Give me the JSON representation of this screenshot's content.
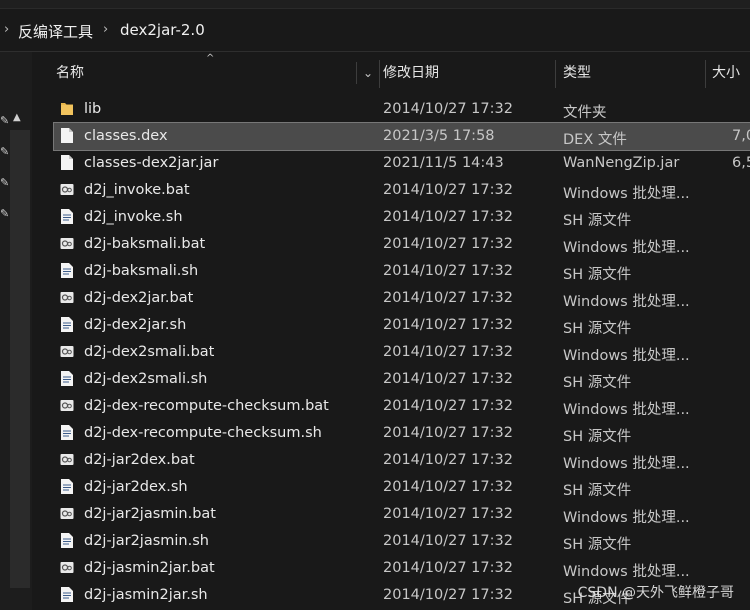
{
  "breadcrumb": {
    "items": [
      "反编译工具",
      "dex2jar-2.0"
    ]
  },
  "columns": {
    "name": "名称",
    "date": "修改日期",
    "type": "类型",
    "size": "大小"
  },
  "files": [
    {
      "name": "lib",
      "date": "2014/10/27 17:32",
      "type": "文件夹",
      "size": "",
      "icon": "folder-icon"
    },
    {
      "name": "classes.dex",
      "date": "2021/3/5 17:58",
      "type": "DEX 文件",
      "size": "7,0",
      "icon": "file-icon",
      "selected": true
    },
    {
      "name": "classes-dex2jar.jar",
      "date": "2021/11/5 14:43",
      "type": "WanNengZip.jar",
      "size": "6,5",
      "icon": "file-icon"
    },
    {
      "name": "d2j_invoke.bat",
      "date": "2014/10/27 17:32",
      "type": "Windows 批处理...",
      "size": "",
      "icon": "batch-file-icon"
    },
    {
      "name": "d2j_invoke.sh",
      "date": "2014/10/27 17:32",
      "type": "SH 源文件",
      "size": "",
      "icon": "script-file-icon"
    },
    {
      "name": "d2j-baksmali.bat",
      "date": "2014/10/27 17:32",
      "type": "Windows 批处理...",
      "size": "",
      "icon": "batch-file-icon"
    },
    {
      "name": "d2j-baksmali.sh",
      "date": "2014/10/27 17:32",
      "type": "SH 源文件",
      "size": "",
      "icon": "script-file-icon"
    },
    {
      "name": "d2j-dex2jar.bat",
      "date": "2014/10/27 17:32",
      "type": "Windows 批处理...",
      "size": "",
      "icon": "batch-file-icon"
    },
    {
      "name": "d2j-dex2jar.sh",
      "date": "2014/10/27 17:32",
      "type": "SH 源文件",
      "size": "",
      "icon": "script-file-icon"
    },
    {
      "name": "d2j-dex2smali.bat",
      "date": "2014/10/27 17:32",
      "type": "Windows 批处理...",
      "size": "",
      "icon": "batch-file-icon"
    },
    {
      "name": "d2j-dex2smali.sh",
      "date": "2014/10/27 17:32",
      "type": "SH 源文件",
      "size": "",
      "icon": "script-file-icon"
    },
    {
      "name": "d2j-dex-recompute-checksum.bat",
      "date": "2014/10/27 17:32",
      "type": "Windows 批处理...",
      "size": "",
      "icon": "batch-file-icon"
    },
    {
      "name": "d2j-dex-recompute-checksum.sh",
      "date": "2014/10/27 17:32",
      "type": "SH 源文件",
      "size": "",
      "icon": "script-file-icon"
    },
    {
      "name": "d2j-jar2dex.bat",
      "date": "2014/10/27 17:32",
      "type": "Windows 批处理...",
      "size": "",
      "icon": "batch-file-icon"
    },
    {
      "name": "d2j-jar2dex.sh",
      "date": "2014/10/27 17:32",
      "type": "SH 源文件",
      "size": "",
      "icon": "script-file-icon"
    },
    {
      "name": "d2j-jar2jasmin.bat",
      "date": "2014/10/27 17:32",
      "type": "Windows 批处理...",
      "size": "",
      "icon": "batch-file-icon"
    },
    {
      "name": "d2j-jar2jasmin.sh",
      "date": "2014/10/27 17:32",
      "type": "SH 源文件",
      "size": "",
      "icon": "script-file-icon"
    },
    {
      "name": "d2j-jasmin2jar.bat",
      "date": "2014/10/27 17:32",
      "type": "Windows 批处理...",
      "size": "",
      "icon": "batch-file-icon"
    },
    {
      "name": "d2j-jasmin2jar.sh",
      "date": "2014/10/27 17:32",
      "type": "SH 源文件",
      "size": "",
      "icon": "script-file-icon"
    }
  ],
  "watermark": "CSDN @天外飞鲜橙子哥",
  "colors": {
    "background": "#191919",
    "selection": "#4b4b4b",
    "folder": "#e8b64a"
  }
}
